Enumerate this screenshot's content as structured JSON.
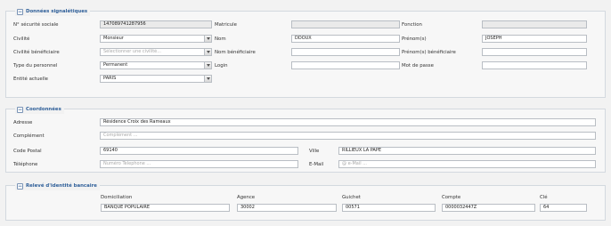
{
  "identity": {
    "title": "Données signalétiques",
    "toggle": "−",
    "nss_label": "N° sécurité sociale",
    "nss_value": "147089741287956",
    "civilite_label": "Civilité",
    "civilite_value": "Monsieur",
    "civ_benef_label": "Civilité bénéficiaire",
    "civ_benef_placeholder": "Sélectionner une civilité...",
    "type_label": "Type du personnel",
    "type_value": "Permanent",
    "entite_label": "Entité actuelle",
    "entite_value": "PARIS",
    "matricule_label": "Matricule",
    "matricule_value": "",
    "nom_label": "Nom",
    "nom_value": "DDOUX",
    "nom_benef_label": "Nom bénéficiaire",
    "nom_benef_value": "",
    "login_label": "Login",
    "login_value": "",
    "fonction_label": "Fonction",
    "fonction_value": "",
    "prenom_label": "Prénom(s)",
    "prenom_value": "JOSEPH",
    "prenom_benef_label": "Prénom(s) bénéficiaire",
    "prenom_benef_value": "",
    "mdp_label": "Mot de passe",
    "mdp_value": ""
  },
  "coords": {
    "title": "Coordonnées",
    "toggle": "−",
    "adresse_label": "Adresse",
    "adresse_value": "Résidence Croix des Rameaux",
    "complement_label": "Complément",
    "complement_placeholder": "Complément ...",
    "cp_label": "Code Postal",
    "cp_value": "69140",
    "ville_label": "Ville",
    "ville_value": "RILLIEUX LA PAPE",
    "tel_label": "Téléphone",
    "tel_placeholder": "Numéro Telephone ...",
    "email_label": "E-Mail",
    "email_placeholder": "@ e-Mail ..."
  },
  "rib": {
    "title": "Relevé d'identité bancaire",
    "toggle": "−",
    "domiciliation_label": "Domiciliation",
    "domiciliation_value": "BANQUE POPULAIRE",
    "agence_label": "Agence",
    "agence_value": "30002",
    "guichet_label": "Guichet",
    "guichet_value": "00571",
    "compte_label": "Compte",
    "compte_value": "0000032447Z",
    "cle_label": "Clé",
    "cle_value": "64"
  }
}
